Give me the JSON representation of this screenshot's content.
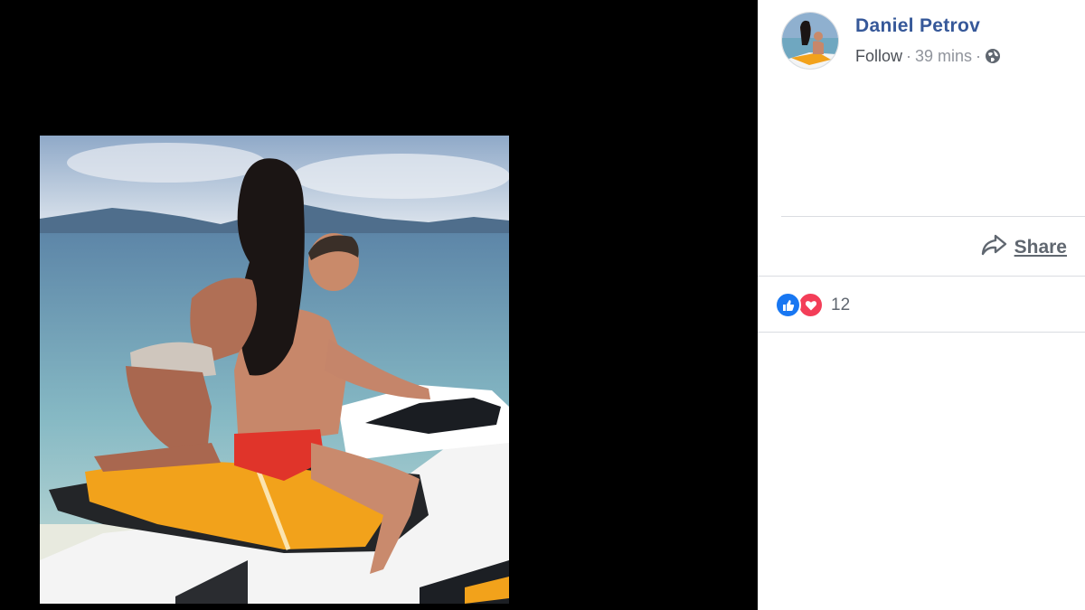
{
  "post": {
    "author_name": "Daniel Petrov",
    "follow_label": "Follow",
    "separator": "·",
    "time": "39 mins",
    "privacy_icon": "globe-icon"
  },
  "actions": {
    "share_label": "Share",
    "share_icon": "share-arrow-icon"
  },
  "reactions": {
    "count": "12",
    "types": [
      "like-icon",
      "love-icon"
    ]
  },
  "colors": {
    "viewer_bg": "#000000",
    "author_link": "#365899",
    "meta_text": "#90949c",
    "like": "#1877f2",
    "love": "#f33e58"
  }
}
